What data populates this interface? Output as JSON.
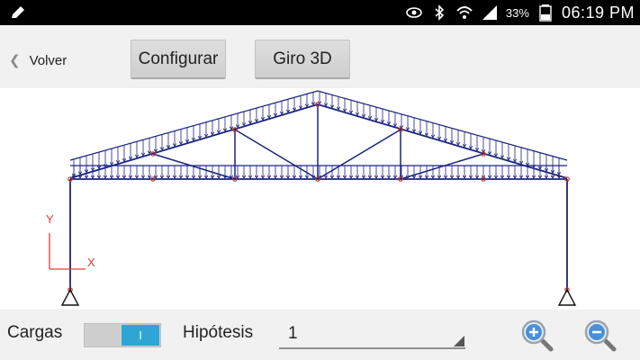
{
  "status_bar": {
    "icons": [
      "pencil-icon",
      "eye-icon",
      "bluetooth-icon",
      "wifi-icon",
      "signal-icon",
      "battery-icon"
    ],
    "battery": "33%",
    "time": "06:19 PM"
  },
  "toolbar": {
    "back_label": "Volver",
    "configure_label": "Configurar",
    "rotate_label": "Giro 3D"
  },
  "drawing": {
    "axis_y_label": "Y",
    "axis_x_label": "X",
    "colors": {
      "structure": "#1a237e",
      "nodes": "#c0392b",
      "axis": "#e53935"
    }
  },
  "bottom_bar": {
    "loads_label": "Cargas",
    "loads_toggle_text": "I",
    "hypothesis_label": "Hipótesis",
    "hypothesis_value": "1",
    "zoom_in_icon": "zoom-in-icon",
    "zoom_out_icon": "zoom-out-icon"
  },
  "colors": {
    "toggle_on": "#2fa5d6",
    "toolbar_bg": "#f1f1f1"
  }
}
